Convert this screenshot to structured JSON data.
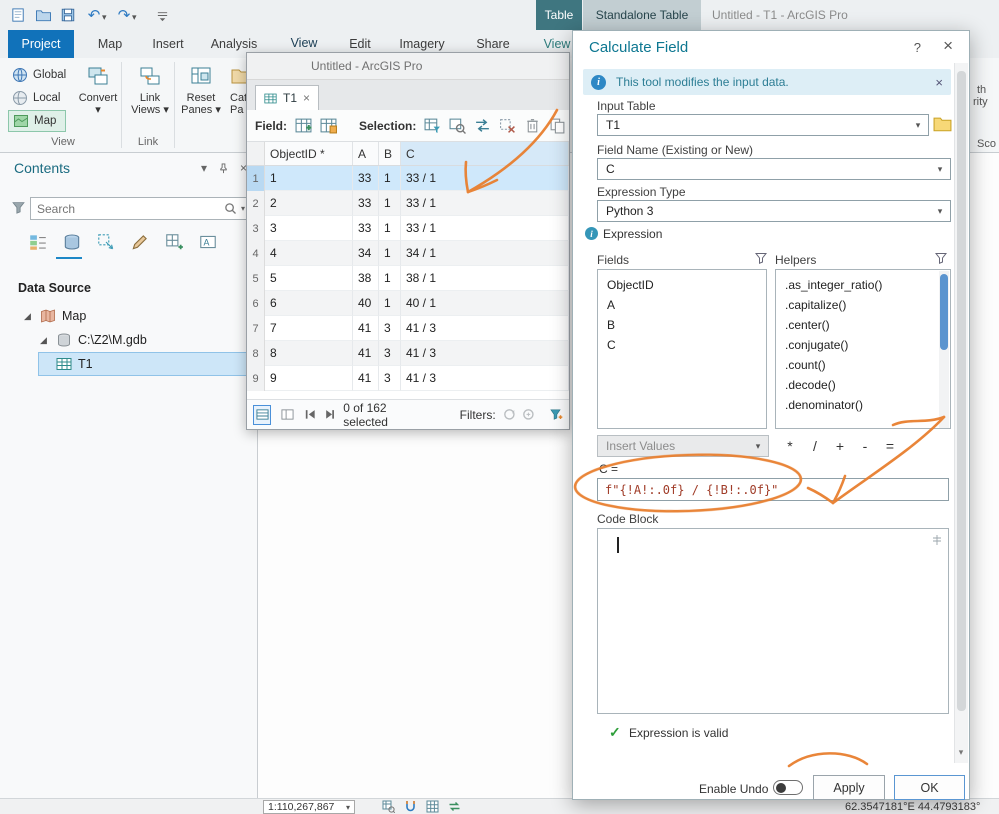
{
  "app": {
    "context_group_1": "Table",
    "context_group_2": "Standalone Table",
    "window_title": "Untitled - T1 - ArcGIS Pro"
  },
  "glyphs": {
    "chevron_down": "▾",
    "close": "×",
    "help": "?",
    "check": "✓",
    "undo": "↶",
    "redo": "↷",
    "more": "•••",
    "expander": "◢",
    "info": "i"
  },
  "ribbon": {
    "tabs": [
      "Project",
      "Map",
      "Insert",
      "Analysis",
      "View",
      "Edit",
      "Imagery",
      "Share",
      "View"
    ],
    "buttons": {
      "global": "Global",
      "local": "Local",
      "map_item": "Map",
      "convert": {
        "line1": "Convert",
        "line2": "▾"
      },
      "link_views": {
        "line1": "Link",
        "line2": "Views ▾"
      },
      "reset_panes": {
        "line1": "Reset",
        "line2": "Panes ▾"
      },
      "catalog": {
        "line1": "Cat",
        "line2": "Pa"
      }
    },
    "groups": {
      "view": "View",
      "link": "Link"
    },
    "fragments": [
      "th",
      "rity",
      "Sco"
    ]
  },
  "contents": {
    "title": "Contents",
    "search_placeholder": "Search",
    "section": "Data Source",
    "tree": [
      {
        "label": "Map"
      },
      {
        "label": "C:\\Z2\\M.gdb"
      },
      {
        "label": "T1"
      }
    ]
  },
  "table_window": {
    "title": "Untitled - ArcGIS Pro",
    "tab": "T1",
    "field_label": "Field:",
    "selection_label": "Selection:",
    "columns": [
      "ObjectID *",
      "A",
      "B",
      "C"
    ],
    "rows": [
      {
        "n": "1",
        "c": [
          "1",
          "33",
          "1",
          "33 / 1"
        ]
      },
      {
        "n": "2",
        "c": [
          "2",
          "33",
          "1",
          "33 / 1"
        ]
      },
      {
        "n": "3",
        "c": [
          "3",
          "33",
          "1",
          "33 / 1"
        ]
      },
      {
        "n": "4",
        "c": [
          "4",
          "34",
          "1",
          "34 / 1"
        ]
      },
      {
        "n": "5",
        "c": [
          "5",
          "38",
          "1",
          "38 / 1"
        ]
      },
      {
        "n": "6",
        "c": [
          "6",
          "40",
          "1",
          "40 / 1"
        ]
      },
      {
        "n": "7",
        "c": [
          "7",
          "41",
          "3",
          "41 / 3"
        ]
      },
      {
        "n": "8",
        "c": [
          "8",
          "41",
          "3",
          "41 / 3"
        ]
      },
      {
        "n": "9",
        "c": [
          "9",
          "41",
          "3",
          "41 / 3"
        ]
      }
    ],
    "status": "0 of 162 selected",
    "filters_label": "Filters:"
  },
  "dialog": {
    "title": "Calculate Field",
    "info_message": "This tool modifies the input data.",
    "input_table_label": "Input Table",
    "input_table_value": "T1",
    "field_name_label": "Field Name (Existing or New)",
    "field_name_value": "C",
    "expression_type_label": "Expression Type",
    "expression_type_value": "Python 3",
    "expression_section_label": "Expression",
    "fields_label": "Fields",
    "helpers_label": "Helpers",
    "fields": [
      "ObjectID",
      "A",
      "B",
      "C"
    ],
    "helpers": [
      ".as_integer_ratio()",
      ".capitalize()",
      ".center()",
      ".conjugate()",
      ".count()",
      ".decode()",
      ".denominator()"
    ],
    "insert_values_label": "Insert Values",
    "operators": [
      "*",
      "/",
      "+",
      "-",
      "="
    ],
    "assignment_label": "C =",
    "expression_value": "f\"{!A!:.0f} / {!B!:.0f}\"",
    "code_block_label": "Code Block",
    "valid_message": "Expression is valid",
    "enable_undo_label": "Enable Undo",
    "apply_label": "Apply",
    "ok_label": "OK"
  },
  "statusbar": {
    "scale": "1:110,267,867",
    "coordinates": "62.3547181°E 44.4793183°"
  },
  "colors": {
    "accent_blue": "#1172ba",
    "teal": "#0d7791",
    "annotation_orange": "#e87f2f",
    "selection_blue": "#cfe8fb"
  }
}
